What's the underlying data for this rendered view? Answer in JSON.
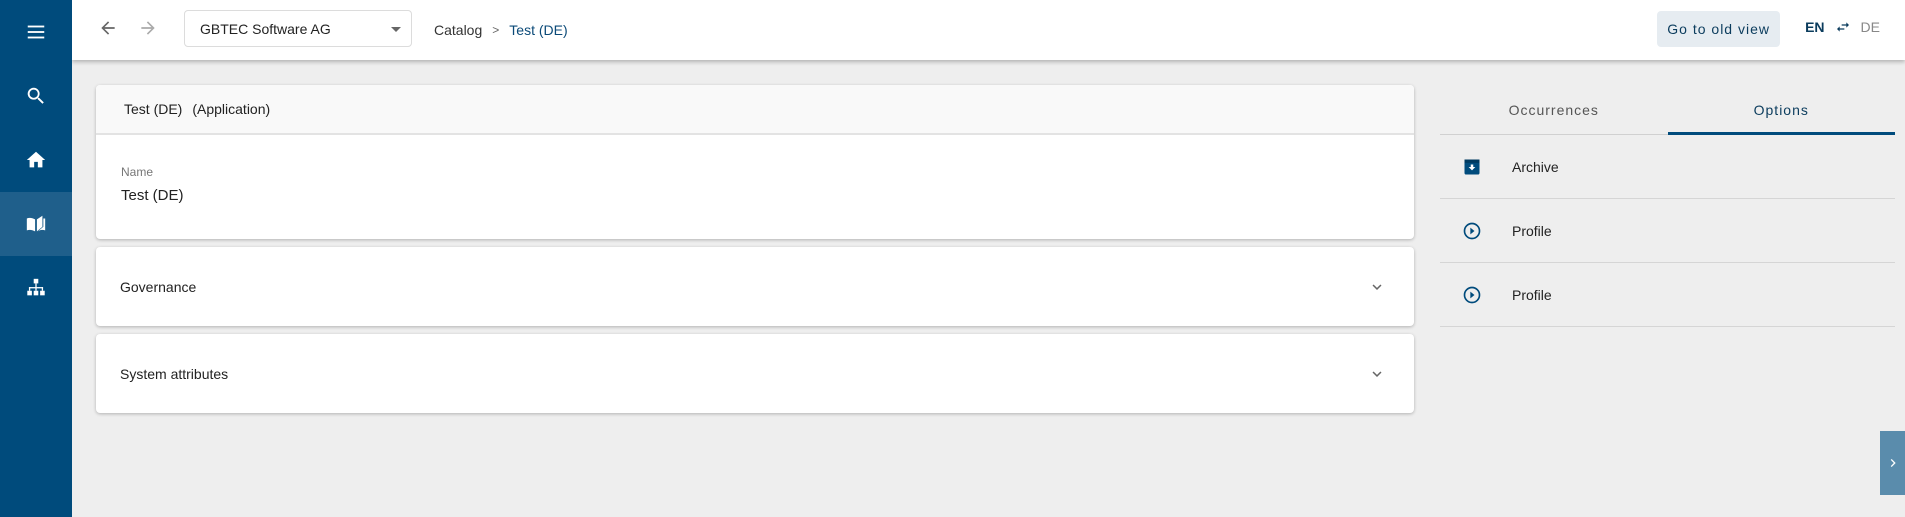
{
  "sidebar": {
    "items": [
      {
        "name": "menu",
        "icon": "menu-icon"
      },
      {
        "name": "search",
        "icon": "search-icon"
      },
      {
        "name": "home",
        "icon": "home-icon"
      },
      {
        "name": "catalog",
        "icon": "book-icon",
        "active": true
      },
      {
        "name": "hierarchy",
        "icon": "sitemap-icon"
      }
    ]
  },
  "header": {
    "company": "GBTEC Software AG",
    "breadcrumb": [
      "Catalog",
      "Test (DE)"
    ],
    "old_view_label": "Go to old view",
    "lang_active": "EN",
    "lang_other": "DE"
  },
  "card": {
    "title": "Test (DE)",
    "type": "(Application)",
    "field_label": "Name",
    "field_value": "Test (DE)"
  },
  "sections": [
    {
      "label": "Governance"
    },
    {
      "label": "System attributes"
    }
  ],
  "right_panel": {
    "tabs": [
      {
        "label": "Occurrences",
        "active": false
      },
      {
        "label": "Options",
        "active": true
      }
    ],
    "options": [
      {
        "label": "Archive",
        "icon": "archive-icon"
      },
      {
        "label": "Profile",
        "icon": "play-circle-icon"
      },
      {
        "label": "Profile",
        "icon": "play-circle-icon"
      }
    ]
  },
  "colors": {
    "brand": "#004b7c",
    "sidebar_active": "#1f5f8b",
    "toggle": "#5a8cac"
  }
}
